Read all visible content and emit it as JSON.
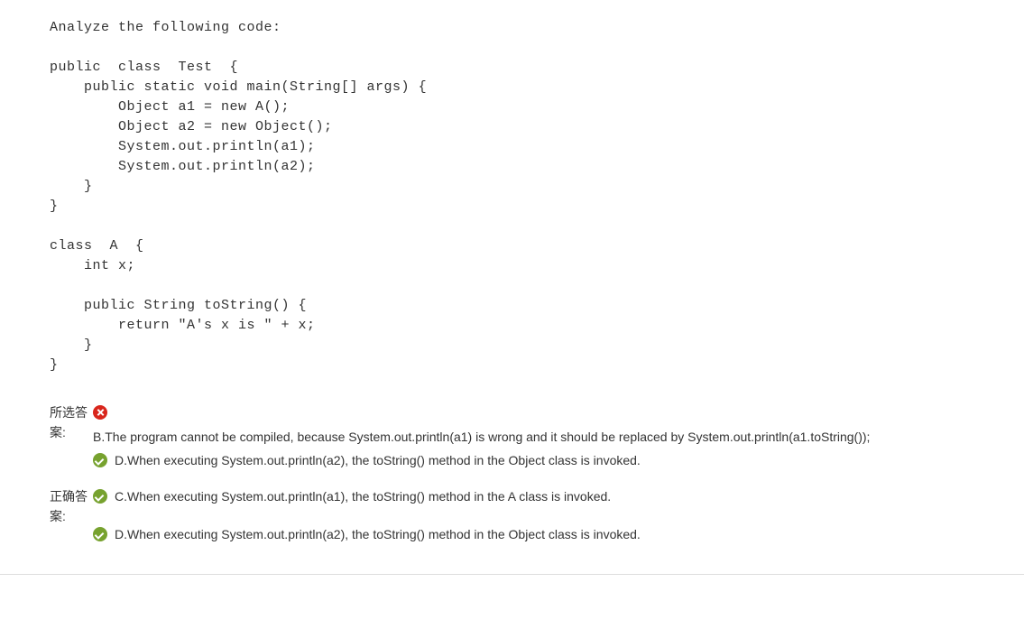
{
  "question": {
    "prompt": "Analyze the following code:",
    "code": "public  class  Test  {\n    public static void main(String[] args) {\n        Object a1 = new A();\n        Object a2 = new Object();\n        System.out.println(a1);\n        System.out.println(a2);\n    }\n}\n\nclass  A  {\n    int x;\n\n    public String toString() {\n        return \"A's x is \" + x;\n    }\n}"
  },
  "selected": {
    "label": "所选答案:",
    "items": [
      {
        "status": "wrong",
        "text": "B.The program cannot be compiled, because System.out.println(a1) is wrong and it should be replaced by System.out.println(a1.toString());"
      },
      {
        "status": "correct",
        "text": "D.When executing System.out.println(a2), the toString() method in the Object class is invoked."
      }
    ]
  },
  "correct": {
    "label": "正确答案:",
    "items": [
      {
        "status": "correct",
        "text": "C.When executing System.out.println(a1), the toString() method in the A class is invoked."
      },
      {
        "status": "correct",
        "text": "D.When executing System.out.println(a2), the toString() method in the Object class is invoked."
      }
    ]
  }
}
